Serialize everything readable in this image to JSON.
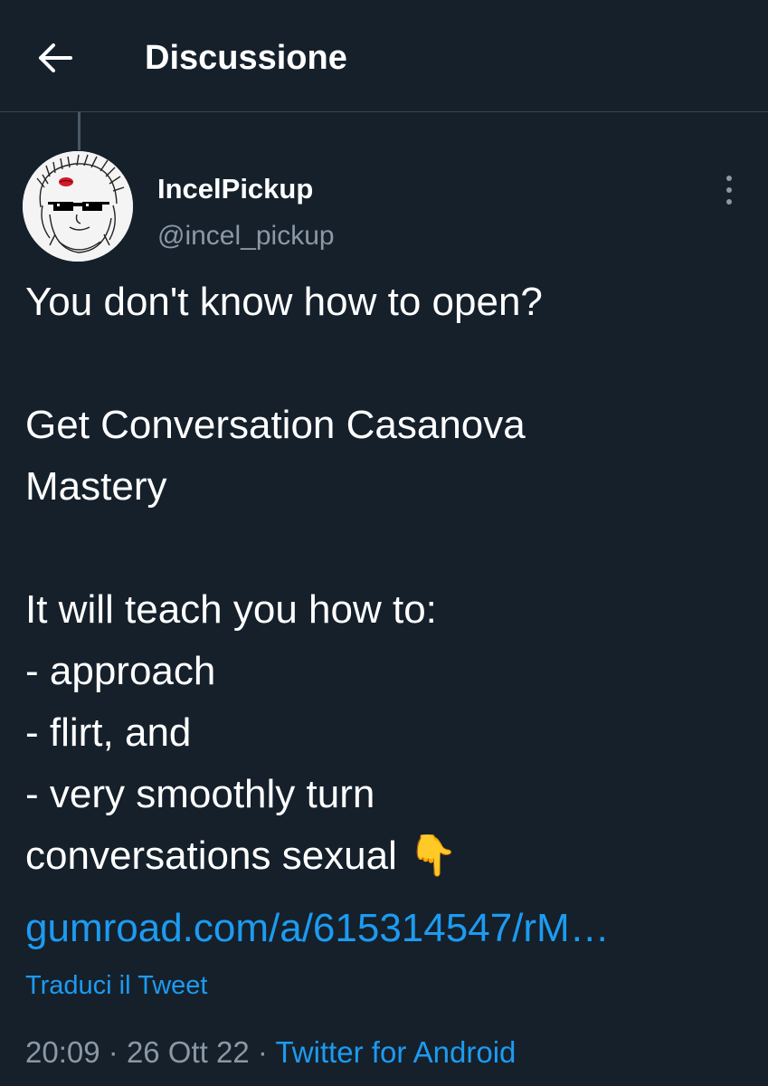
{
  "header": {
    "title": "Discussione",
    "back_icon": "arrow-left-icon"
  },
  "tweet": {
    "author": {
      "display_name": "IncelPickup",
      "handle": "@incel_pickup",
      "avatar_icon": "avatar-image"
    },
    "more_icon": "more-vertical-icon",
    "text_lines": {
      "line1": "You don't know how to open?",
      "line2": "Get Conversation Casanova",
      "line3": "Mastery",
      "line4": "It will teach you how to:",
      "line5": "- approach",
      "line6": "- flirt, and",
      "line7": "- very smoothly turn",
      "line8": "conversations sexual"
    },
    "emoji": "👇",
    "link": "gumroad.com/a/615314547/rM…",
    "translate_label": "Traduci il Tweet",
    "time": "20:09",
    "separator": "·",
    "date": "26 Ott 22",
    "source": "Twitter for Android"
  },
  "colors": {
    "background": "#15202b",
    "text": "#ffffff",
    "secondary_text": "#8b98a5",
    "accent": "#1d9bf0",
    "border": "#38444d"
  }
}
